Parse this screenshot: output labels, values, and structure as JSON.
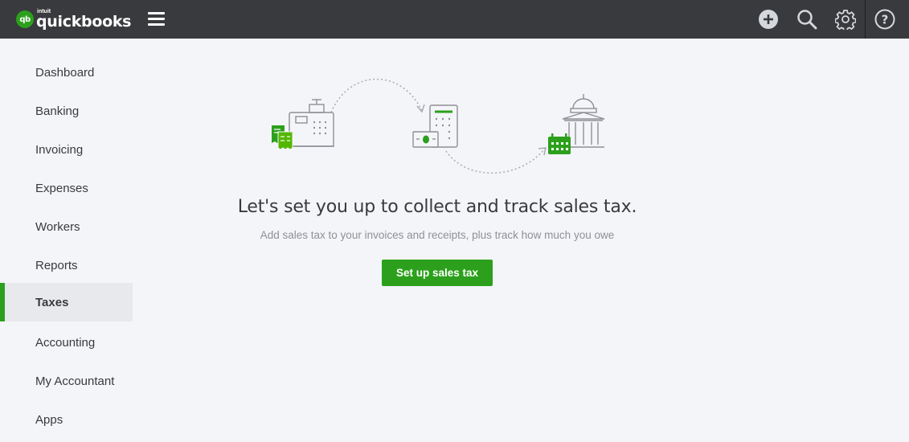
{
  "brand": {
    "intuit": "intuit",
    "name": "quickbooks",
    "badge": "qb",
    "accent_color": "#2ca01c",
    "topbar_color": "#393a3d"
  },
  "header": {
    "menu_icon": "hamburger-menu-icon",
    "actions": [
      {
        "name": "new",
        "icon": "plus-circle-icon"
      },
      {
        "name": "search",
        "icon": "search-icon"
      },
      {
        "name": "settings",
        "icon": "gear-icon"
      },
      {
        "name": "help",
        "icon": "help-icon"
      }
    ]
  },
  "sidebar": {
    "items": [
      {
        "label": "Dashboard",
        "active": false
      },
      {
        "label": "Banking",
        "active": false
      },
      {
        "label": "Invoicing",
        "active": false
      },
      {
        "label": "Expenses",
        "active": false
      },
      {
        "label": "Workers",
        "active": false
      },
      {
        "label": "Reports",
        "active": false
      },
      {
        "label": "Taxes",
        "active": true
      },
      {
        "label": "Accounting",
        "active": false
      },
      {
        "label": "My Accountant",
        "active": false
      },
      {
        "label": "Apps",
        "active": false
      }
    ]
  },
  "main": {
    "illustration_icons": [
      "cash-register-icon",
      "receipt-icon",
      "calculator-icon",
      "government-building-icon",
      "calendar-icon"
    ],
    "headline": "Let's set you up to collect and track sales tax.",
    "subline": "Add sales tax to your invoices and receipts, plus track how much you owe",
    "cta_label": "Set up sales tax"
  }
}
